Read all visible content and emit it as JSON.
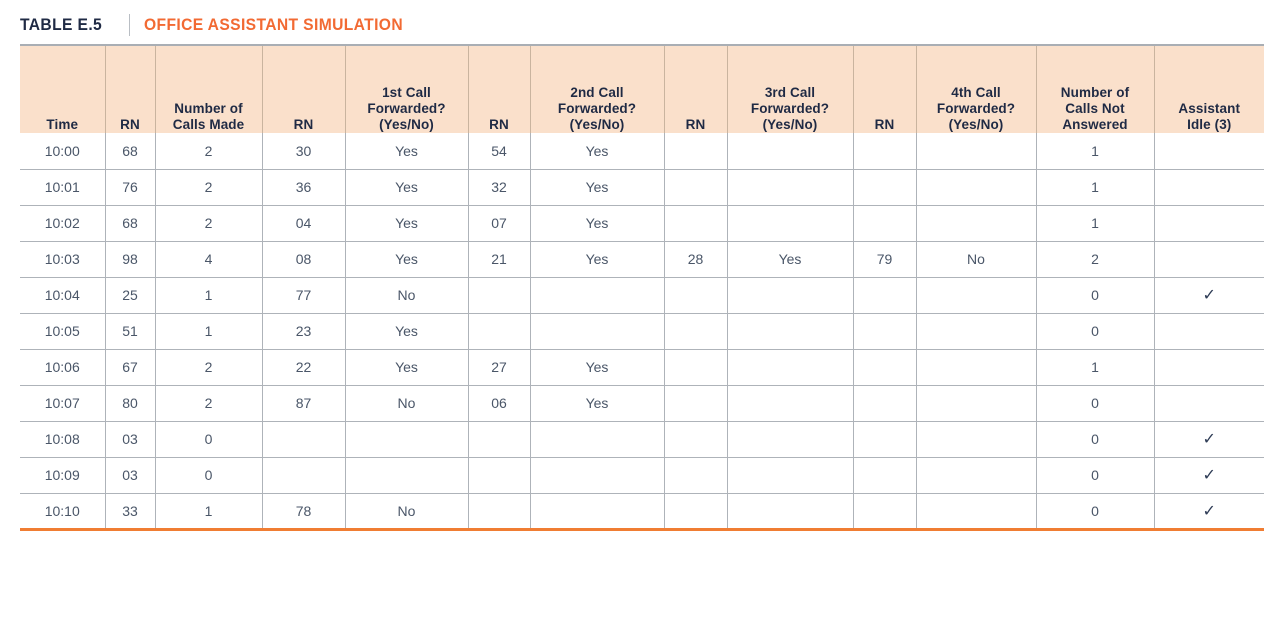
{
  "title": {
    "label": "TABLE E.5",
    "name": "OFFICE ASSISTANT SIMULATION"
  },
  "colors": {
    "accent_orange": "#f26a33",
    "header_bg": "#fae0cb",
    "header_text": "#1f2a44",
    "body_text": "#4a5668",
    "rule": "#aeb3b9",
    "bottom_rule": "#f07d33"
  },
  "table": {
    "columns": [
      {
        "key": "time",
        "lines": [
          "Time"
        ]
      },
      {
        "key": "rn1",
        "lines": [
          "RN"
        ]
      },
      {
        "key": "made",
        "lines": [
          "Number of",
          "Calls Made"
        ]
      },
      {
        "key": "rn2",
        "lines": [
          "RN"
        ]
      },
      {
        "key": "q1",
        "lines": [
          "1st Call",
          "Forwarded?",
          "(Yes/No)"
        ]
      },
      {
        "key": "rn3",
        "lines": [
          "RN"
        ]
      },
      {
        "key": "q2",
        "lines": [
          "2nd Call",
          "Forwarded?",
          "(Yes/No)"
        ]
      },
      {
        "key": "rn4",
        "lines": [
          "RN"
        ]
      },
      {
        "key": "q3",
        "lines": [
          "3rd Call",
          "Forwarded?",
          "(Yes/No)"
        ]
      },
      {
        "key": "rn5",
        "lines": [
          "RN"
        ]
      },
      {
        "key": "q4",
        "lines": [
          "4th Call",
          "Forwarded?",
          "(Yes/No)"
        ]
      },
      {
        "key": "nans",
        "lines": [
          "Number of",
          "Calls Not",
          "Answered"
        ]
      },
      {
        "key": "idle",
        "lines": [
          "Assistant",
          "Idle (3)"
        ]
      }
    ],
    "rows": [
      {
        "time": "10:00",
        "rn1": "68",
        "made": "2",
        "rn2": "30",
        "q1": "Yes",
        "rn3": "54",
        "q2": "Yes",
        "rn4": "",
        "q3": "",
        "rn5": "",
        "q4": "",
        "nans": "1",
        "idle": ""
      },
      {
        "time": "10:01",
        "rn1": "76",
        "made": "2",
        "rn2": "36",
        "q1": "Yes",
        "rn3": "32",
        "q2": "Yes",
        "rn4": "",
        "q3": "",
        "rn5": "",
        "q4": "",
        "nans": "1",
        "idle": ""
      },
      {
        "time": "10:02",
        "rn1": "68",
        "made": "2",
        "rn2": "04",
        "q1": "Yes",
        "rn3": "07",
        "q2": "Yes",
        "rn4": "",
        "q3": "",
        "rn5": "",
        "q4": "",
        "nans": "1",
        "idle": ""
      },
      {
        "time": "10:03",
        "rn1": "98",
        "made": "4",
        "rn2": "08",
        "q1": "Yes",
        "rn3": "21",
        "q2": "Yes",
        "rn4": "28",
        "q3": "Yes",
        "rn5": "79",
        "q4": "No",
        "nans": "2",
        "idle": ""
      },
      {
        "time": "10:04",
        "rn1": "25",
        "made": "1",
        "rn2": "77",
        "q1": "No",
        "rn3": "",
        "q2": "",
        "rn4": "",
        "q3": "",
        "rn5": "",
        "q4": "",
        "nans": "0",
        "idle": "✓"
      },
      {
        "time": "10:05",
        "rn1": "51",
        "made": "1",
        "rn2": "23",
        "q1": "Yes",
        "rn3": "",
        "q2": "",
        "rn4": "",
        "q3": "",
        "rn5": "",
        "q4": "",
        "nans": "0",
        "idle": ""
      },
      {
        "time": "10:06",
        "rn1": "67",
        "made": "2",
        "rn2": "22",
        "q1": "Yes",
        "rn3": "27",
        "q2": "Yes",
        "rn4": "",
        "q3": "",
        "rn5": "",
        "q4": "",
        "nans": "1",
        "idle": ""
      },
      {
        "time": "10:07",
        "rn1": "80",
        "made": "2",
        "rn2": "87",
        "q1": "No",
        "rn3": "06",
        "q2": "Yes",
        "rn4": "",
        "q3": "",
        "rn5": "",
        "q4": "",
        "nans": "0",
        "idle": ""
      },
      {
        "time": "10:08",
        "rn1": "03",
        "made": "0",
        "rn2": "",
        "q1": "",
        "rn3": "",
        "q2": "",
        "rn4": "",
        "q3": "",
        "rn5": "",
        "q4": "",
        "nans": "0",
        "idle": "✓"
      },
      {
        "time": "10:09",
        "rn1": "03",
        "made": "0",
        "rn2": "",
        "q1": "",
        "rn3": "",
        "q2": "",
        "rn4": "",
        "q3": "",
        "rn5": "",
        "q4": "",
        "nans": "0",
        "idle": "✓"
      },
      {
        "time": "10:10",
        "rn1": "33",
        "made": "1",
        "rn2": "78",
        "q1": "No",
        "rn3": "",
        "q2": "",
        "rn4": "",
        "q3": "",
        "rn5": "",
        "q4": "",
        "nans": "0",
        "idle": "✓"
      }
    ]
  }
}
